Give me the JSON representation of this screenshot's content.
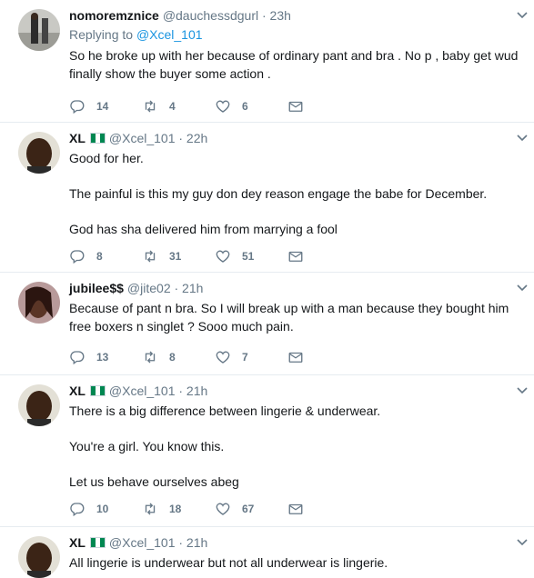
{
  "tweets": [
    {
      "name": "nomoremznice",
      "handle": "@dauchessdgurl · 23h",
      "reply_prefix": "Replying to",
      "reply_to": "@Xcel_101",
      "lines": [
        "So he broke up with her because of ordinary pant and bra . No p , baby get wud finally show the buyer some action ."
      ],
      "replies": "14",
      "retweets": "4",
      "likes": "6"
    },
    {
      "name": "XL",
      "handle": "@Xcel_101 · 22h",
      "lines": [
        "Good for her.",
        "The painful is this my guy don dey reason engage the babe for December.",
        "God has sha delivered him from marrying a fool"
      ],
      "replies": "8",
      "retweets": "31",
      "likes": "51"
    },
    {
      "name": "jubilee$$",
      "handle": "@jite02 · 21h",
      "lines": [
        "Because of pant n bra. So I will break up with a man because they bought him free boxers n singlet ?  Sooo much pain."
      ],
      "replies": "13",
      "retweets": "8",
      "likes": "7"
    },
    {
      "name": "XL",
      "handle": "@Xcel_101 · 21h",
      "lines": [
        "There is a big difference between lingerie & underwear.",
        "You're a girl. You know this.",
        "Let us behave ourselves abeg"
      ],
      "replies": "10",
      "retweets": "18",
      "likes": "67"
    },
    {
      "name": "XL",
      "handle": "@Xcel_101 · 21h",
      "lines": [
        "All lingerie is underwear but not all underwear is lingerie."
      ]
    }
  ]
}
